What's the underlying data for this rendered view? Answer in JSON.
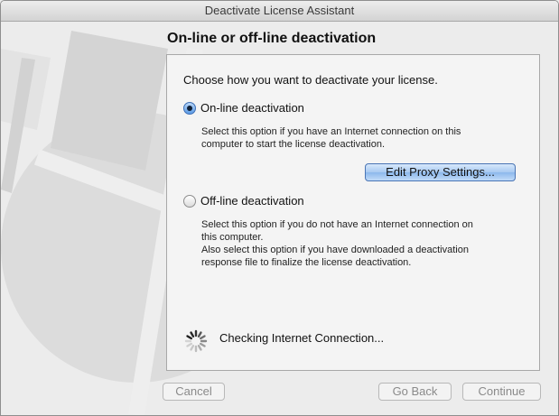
{
  "window": {
    "title": "Deactivate License Assistant"
  },
  "page": {
    "title": "On-line or off-line deactivation"
  },
  "panel": {
    "question": "Choose how you want to deactivate your license.",
    "online": {
      "label": "On-line deactivation",
      "selected": true,
      "description": [
        "Select this option if you have an Internet connection on this",
        "computer to start the license deactivation."
      ],
      "proxy_button": "Edit Proxy Settings..."
    },
    "offline": {
      "label": "Off-line deactivation",
      "selected": false,
      "description": [
        "Select this option if you do not have an Internet connection on",
        "this computer.",
        "Also select this option if you have downloaded a deactivation",
        "response file to finalize the license deactivation."
      ]
    },
    "status": {
      "icon": "spinner-icon",
      "text": "Checking Internet Connection..."
    }
  },
  "buttons": {
    "cancel": "Cancel",
    "go_back": "Go Back",
    "continue": "Continue"
  },
  "colors": {
    "accent": "#5b9be6",
    "window_bg": "#ececec",
    "panel_bg": "#f4f4f4"
  }
}
